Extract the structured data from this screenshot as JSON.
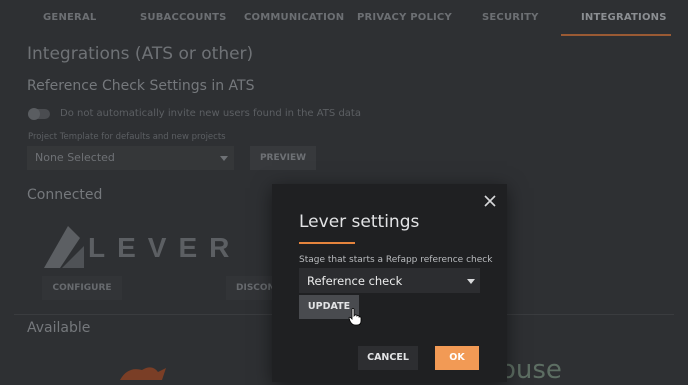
{
  "tabs": [
    {
      "label": "GENERAL"
    },
    {
      "label": "SUBACCOUNTS"
    },
    {
      "label": "COMMUNICATION"
    },
    {
      "label": "PRIVACY POLICY"
    },
    {
      "label": "SECURITY"
    },
    {
      "label": "INTEGRATIONS",
      "active": true
    }
  ],
  "page": {
    "title": "Integrations (ATS or other)",
    "reference_section_title": "Reference Check Settings in ATS",
    "toggle_label": "Do not automatically invite new users found in the ATS data",
    "project_template_label": "Project Template for defaults and new projects",
    "project_template_value": "None Selected",
    "preview_label": "PREVIEW",
    "connected_title": "Connected",
    "lever_wordmark": "LEVER",
    "configure_label": "CONFIGURE",
    "disconnect_label": "DISCON",
    "available_title": "Available",
    "partial_logo_text": "ouse"
  },
  "modal": {
    "title": "Lever settings",
    "stage_label": "Stage that starts a Refapp reference check",
    "stage_value": "Reference check",
    "update_label": "UPDATE",
    "cancel_label": "CANCEL",
    "ok_label": "OK"
  },
  "colors": {
    "accent": "#e5843d",
    "ok_button": "#f29a55"
  }
}
